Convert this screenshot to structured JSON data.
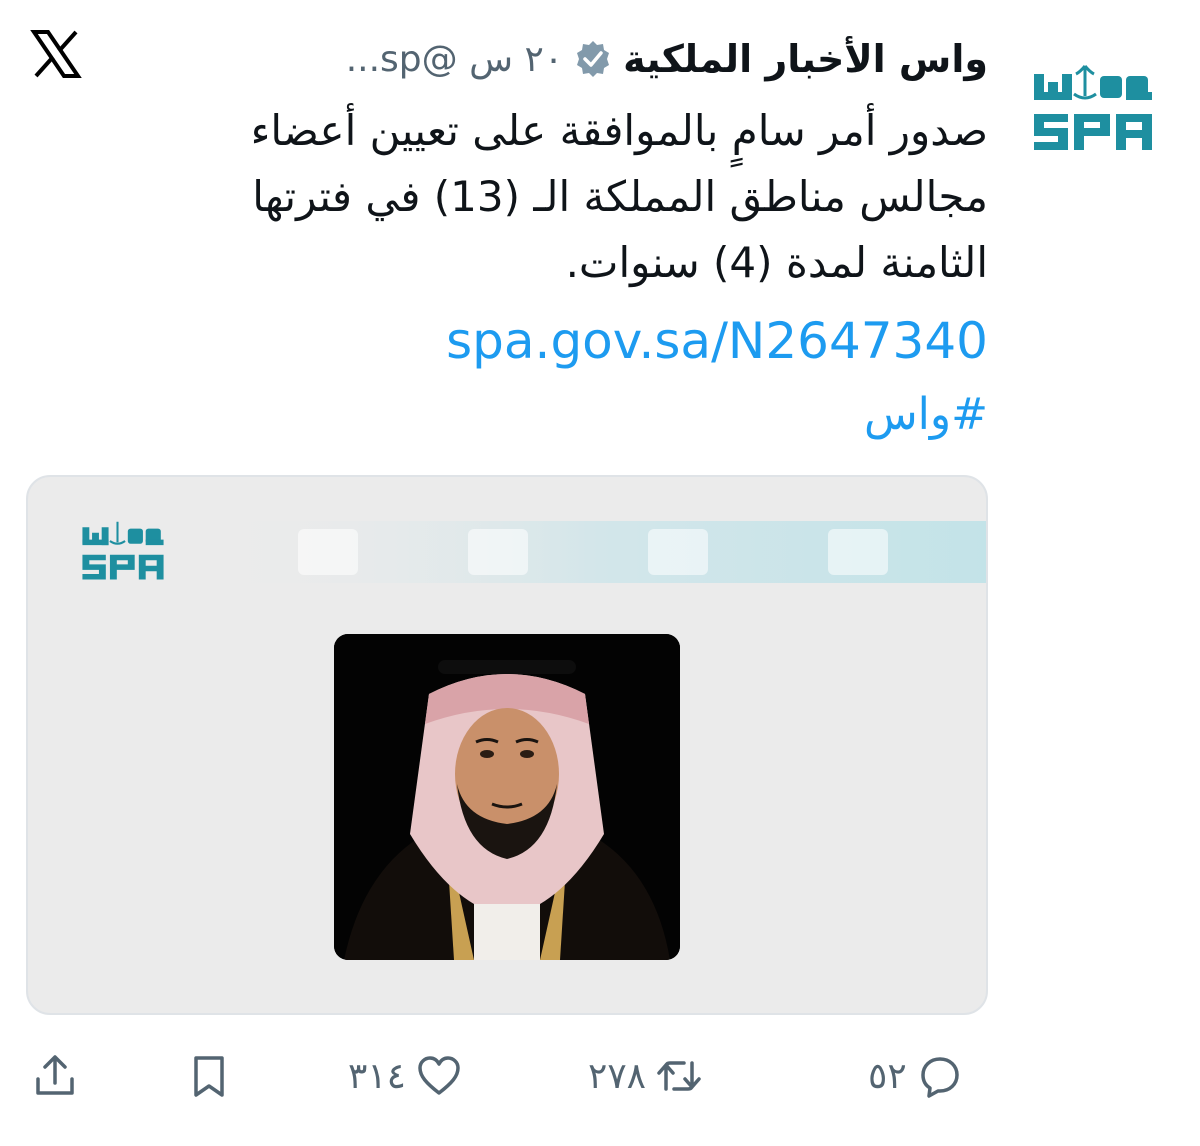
{
  "header": {
    "display_name": "واس الأخبار الملكية",
    "handle_time": "٢٠ س @sp...",
    "verified_icon": "verified-badge-icon"
  },
  "tweet": {
    "lines": [
      "صدور أمر سامٍ بالموافقة على تعيين أعضاء",
      "مجالس مناطق المملكة الـ (13) في فترتها",
      "الثامنة لمدة (4) سنوات."
    ],
    "link": "spa.gov.sa/N2647340",
    "hashtag": "#واس"
  },
  "card": {
    "logo_text_top": "واس",
    "logo_text_bottom": "SPA"
  },
  "actions": {
    "replies": "٥٢",
    "reposts": "٢٧٨",
    "likes": "٣١٤"
  },
  "colors": {
    "accent": "#1d9bf0",
    "spa_teal": "#1e8fa0",
    "muted": "#536471"
  }
}
